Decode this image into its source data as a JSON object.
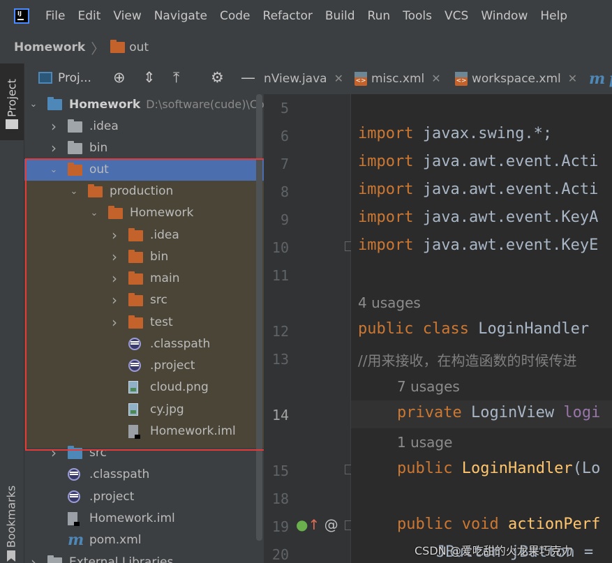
{
  "menu": {
    "items": [
      "File",
      "Edit",
      "View",
      "Navigate",
      "Code",
      "Refactor",
      "Build",
      "Run",
      "Tools",
      "VCS",
      "Window",
      "Help"
    ]
  },
  "breadcrumb": {
    "project": "Homework",
    "current": "out"
  },
  "side_stripe": {
    "project_label": "Project",
    "bookmarks_label": "Bookmarks"
  },
  "project_panel": {
    "title": "Proj...",
    "header_icons": [
      "target-icon",
      "expand-all-icon",
      "collapse-all-icon",
      "gear-icon",
      "minimize-icon"
    ],
    "tree": [
      {
        "label": "Homework",
        "path": "D:\\software(cude)\\Co",
        "arrow": "open",
        "icon": "module-folder",
        "bold": true
      },
      {
        "label": ".idea",
        "arrow": "closed",
        "icon": "folder-gray"
      },
      {
        "label": "bin",
        "arrow": "closed",
        "icon": "folder-gray"
      },
      {
        "label": "out",
        "arrow": "open",
        "icon": "folder-orange",
        "selected": true
      },
      {
        "label": "production",
        "arrow": "open",
        "icon": "folder-orange"
      },
      {
        "label": "Homework",
        "arrow": "open",
        "icon": "folder-orange"
      },
      {
        "label": ".idea",
        "arrow": "closed",
        "icon": "folder-orange"
      },
      {
        "label": "bin",
        "arrow": "closed",
        "icon": "folder-orange"
      },
      {
        "label": "main",
        "arrow": "closed",
        "icon": "folder-orange"
      },
      {
        "label": "src",
        "arrow": "closed",
        "icon": "folder-orange"
      },
      {
        "label": "test",
        "arrow": "closed",
        "icon": "folder-orange"
      },
      {
        "label": ".classpath",
        "arrow": "none",
        "icon": "eclipse-file"
      },
      {
        "label": ".project",
        "arrow": "none",
        "icon": "eclipse-file"
      },
      {
        "label": "cloud.png",
        "arrow": "none",
        "icon": "image-file"
      },
      {
        "label": "cy.jpg",
        "arrow": "none",
        "icon": "image-file"
      },
      {
        "label": "Homework.iml",
        "arrow": "none",
        "icon": "iml-file"
      },
      {
        "label": "src",
        "arrow": "closed",
        "icon": "folder-blue"
      },
      {
        "label": ".classpath",
        "arrow": "none",
        "icon": "eclipse-file"
      },
      {
        "label": ".project",
        "arrow": "none",
        "icon": "eclipse-file"
      },
      {
        "label": "Homework.iml",
        "arrow": "none",
        "icon": "iml-file"
      },
      {
        "label": "pom.xml",
        "arrow": "none",
        "icon": "maven-file"
      },
      {
        "label": "External Libraries",
        "arrow": "closed",
        "icon": "libraries"
      }
    ]
  },
  "editor": {
    "tabs": [
      {
        "label": "nView.java",
        "icon": "none"
      },
      {
        "label": "misc.xml",
        "icon": "xml"
      },
      {
        "label": "workspace.xml",
        "icon": "xml"
      },
      {
        "label": "p",
        "icon": "maven"
      }
    ],
    "line_numbers": [
      "5",
      "6",
      "7",
      "8",
      "9",
      "10",
      "11",
      "12",
      "13",
      "14",
      "15",
      "18",
      "19",
      "20"
    ],
    "current_line": "14",
    "code": {
      "l6": [
        "import",
        " javax.swing.*;"
      ],
      "l7": [
        "import",
        " java.awt.event.Acti"
      ],
      "l8": [
        "import",
        " java.awt.event.Acti"
      ],
      "l9": [
        "import",
        " java.awt.event.KeyA"
      ],
      "l10": [
        "import",
        " java.awt.event.KeyE"
      ],
      "usage_class": "4 usages",
      "l12": [
        "public class",
        " LoginHandler"
      ],
      "l13": "//用来接收，在构造函数的时候传进",
      "usage_field": "7 usages",
      "l14": [
        "private",
        " LoginView ",
        "logi"
      ],
      "usage_ctor": "1 usage",
      "l15": [
        "public",
        " ",
        "LoginHandler",
        "(Lo"
      ],
      "l19": [
        "public void",
        " ",
        "actionPerf"
      ],
      "l20": "JButton jButton ="
    },
    "gutter_at": "@"
  },
  "watermark": "CSDN @爱吃甜的火龙果巧克力",
  "colors": {
    "background": "#2b2b2b",
    "panel": "#3c3f41",
    "selection": "#4b6eaf",
    "highlight": "#4a4536",
    "annotation_box": "#e33a3a",
    "keyword": "#cc7832",
    "method": "#ffc66d"
  }
}
